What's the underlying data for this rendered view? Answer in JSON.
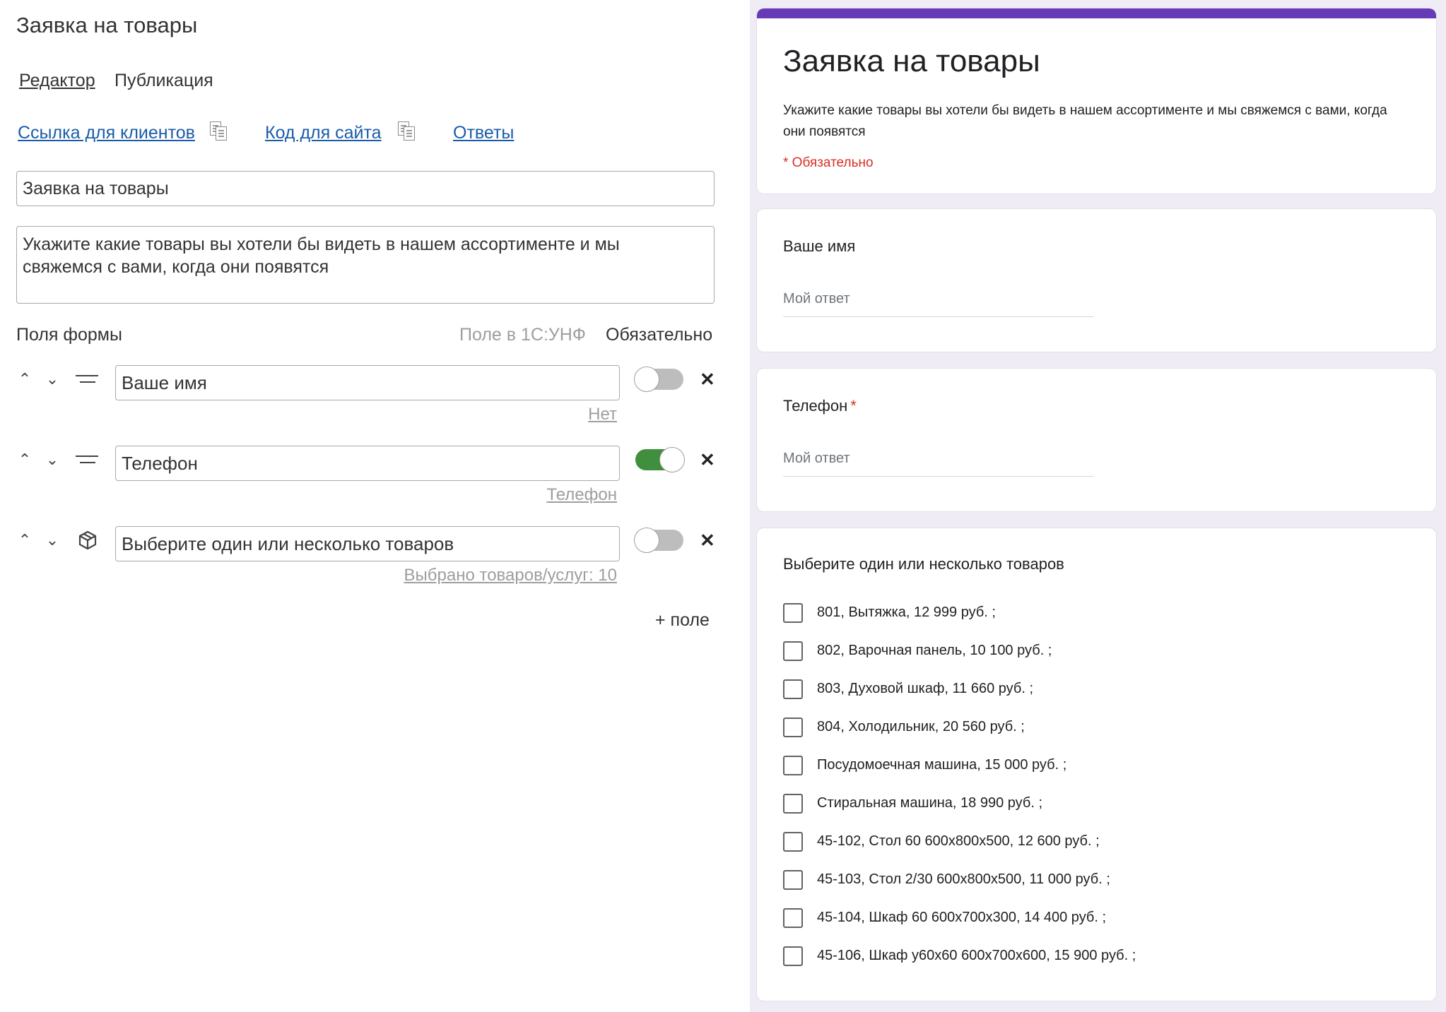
{
  "editor": {
    "title": "Заявка на товары",
    "tabs": [
      "Редактор",
      "Публикация"
    ],
    "links": {
      "client_link": "Ссылка для клиентов",
      "site_code": "Код для сайта",
      "answers": "Ответы"
    },
    "form_title_value": "Заявка на товары",
    "form_description_value": "Укажите какие товары вы хотели бы видеть в нашем ассортименте и мы\nсвяжемся с вами, когда они появятся",
    "fields_header": {
      "label": "Поля формы",
      "field_1c": "Поле в 1С:УНФ",
      "required": "Обязательно"
    },
    "fields": [
      {
        "name": "Ваше имя",
        "type_icon": "lines-icon",
        "required": false,
        "mapping": "Нет"
      },
      {
        "name": "Телефон",
        "type_icon": "lines-icon",
        "required": true,
        "mapping": "Телефон"
      },
      {
        "name": "Выберите один или несколько товаров",
        "type_icon": "box-icon",
        "required": false,
        "mapping": "Выбрано товаров/услуг: 10"
      }
    ],
    "add_field_label": "+ поле",
    "toggle_on_color": "#3f8f3f",
    "link_color": "#1a5ca8"
  },
  "preview": {
    "accent_color": "#673ab7",
    "title": "Заявка на товары",
    "description": "Укажите какие товары вы хотели бы видеть в нашем ассортименте и мы свяжемся с вами, когда они появятся",
    "required_note": "* Обязательно",
    "questions": [
      {
        "title": "Ваше имя",
        "required": false,
        "placeholder": "Мой ответ"
      },
      {
        "title": "Телефон",
        "required": true,
        "required_mark": "*",
        "placeholder": "Мой ответ"
      },
      {
        "title": "Выберите один или несколько товаров",
        "options": [
          "801, Вытяжка, 12 999 руб. ;",
          "802, Варочная панель, 10 100 руб. ;",
          "803, Духовой шкаф, 11 660 руб. ;",
          "804, Холодильник, 20 560 руб. ;",
          "Посудомоечная машина, 15 000 руб. ;",
          "Стиральная машина, 18 990 руб. ;",
          "45-102, Стол 60 600х800х500, 12 600 руб. ;",
          "45-103, Стол 2/30 600х800х500, 11 000 руб. ;",
          "45-104, Шкаф 60 600х700х300, 14 400 руб. ;",
          "45-106, Шкаф у60х60 600х700х600, 15 900 руб. ;"
        ]
      }
    ]
  }
}
